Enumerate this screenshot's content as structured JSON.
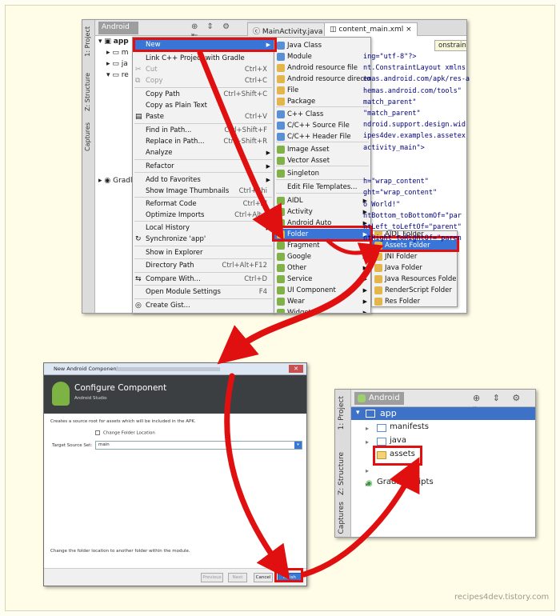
{
  "ide": {
    "vtabs": [
      "1: Project",
      "Z: Structure",
      "Captures"
    ],
    "project_dropdown": "Android",
    "tree": [
      {
        "label": "app"
      },
      {
        "label": "m"
      },
      {
        "label": "ja"
      },
      {
        "label": "re"
      },
      {
        "label": "Gradl"
      }
    ],
    "editor_tabs": [
      "MainActivity.java",
      "content_main.xml"
    ],
    "tooltip": "onstraintLayout",
    "code_lines": [
      "ing=\"utf-8\"?>",
      "nt.ConstraintLayout xmlns",
      "emas.android.com/apk/res-a",
      "hemas.android.com/tools\"",
      "match_parent\"",
      "\"match_parent\"",
      "ndroid.support.design.wid",
      "ipes4dev.examples.assetex",
      "activity_main\">",
      "",
      "",
      "h=\"wrap_content\"",
      "ght=\"wrap_content\"",
      "o World!\"",
      "ntBottom_toBottomOf=\"par",
      "ntLeft_toLeftOf=\"parent\"",
      "ntRight_toRightOf=\"paren"
    ],
    "context_menu": [
      {
        "label": "New",
        "shortcut": "",
        "state": "highlight",
        "submenu": true
      },
      {
        "label": "Link C++ Project with Gradle",
        "shortcut": "",
        "state": "normal"
      },
      {
        "label": "Cut",
        "shortcut": "Ctrl+X",
        "state": "disabled"
      },
      {
        "label": "Copy",
        "shortcut": "Ctrl+C",
        "state": "disabled"
      },
      {
        "label": "Copy Path",
        "shortcut": "Ctrl+Shift+C",
        "state": "normal"
      },
      {
        "label": "Copy as Plain Text",
        "shortcut": "",
        "state": "normal"
      },
      {
        "label": "Paste",
        "shortcut": "Ctrl+V",
        "state": "normal"
      },
      {
        "label": "Find in Path...",
        "shortcut": "Ctrl+Shift+F",
        "state": "normal"
      },
      {
        "label": "Replace in Path...",
        "shortcut": "Ctrl+Shift+R",
        "state": "normal"
      },
      {
        "label": "Analyze",
        "shortcut": "",
        "state": "normal",
        "submenu": true
      },
      {
        "label": "Refactor",
        "shortcut": "",
        "state": "normal",
        "submenu": true
      },
      {
        "label": "Add to Favorites",
        "shortcut": "",
        "state": "normal",
        "submenu": true
      },
      {
        "label": "Show Image Thumbnails",
        "shortcut": "Ctrl+Shi",
        "state": "normal"
      },
      {
        "label": "Reformat Code",
        "shortcut": "Ctrl+Al",
        "state": "normal"
      },
      {
        "label": "Optimize Imports",
        "shortcut": "Ctrl+Alt+",
        "state": "normal"
      },
      {
        "label": "Local History",
        "shortcut": "",
        "state": "normal",
        "submenu": true
      },
      {
        "label": "Synchronize 'app'",
        "shortcut": "",
        "state": "normal"
      },
      {
        "label": "Show in Explorer",
        "shortcut": "",
        "state": "normal"
      },
      {
        "label": "Directory Path",
        "shortcut": "Ctrl+Alt+F12",
        "state": "normal"
      },
      {
        "label": "Compare With...",
        "shortcut": "Ctrl+D",
        "state": "normal"
      },
      {
        "label": "Open Module Settings",
        "shortcut": "F4",
        "state": "normal"
      },
      {
        "label": "Create Gist...",
        "shortcut": "",
        "state": "normal"
      }
    ],
    "new_submenu": [
      "Java Class",
      "Module",
      "Android resource file",
      "Android resource directory",
      "File",
      "Package",
      "C++ Class",
      "C/C++ Source File",
      "C/C++ Header File",
      "Image Asset",
      "Vector Asset",
      "Singleton",
      "Edit File Templates...",
      "AIDL",
      "Activity",
      "Android Auto",
      "Folder",
      "Fragment",
      "Google",
      "Other",
      "Service",
      "UI Component",
      "Wear",
      "Widget"
    ],
    "folder_submenu": [
      "AIDL Folder",
      "Assets Folder",
      "JNI Folder",
      "Java Folder",
      "Java Resources Folder",
      "RenderScript Folder",
      "Res Folder"
    ]
  },
  "dialog": {
    "window_title": "New Android Component",
    "close_glyph": "✕",
    "title": "Configure Component",
    "subtitle": "Android Studio",
    "description": "Creates a source root for assets which will be included in the APK.",
    "checkbox_label": "Change Folder Location",
    "target_label": "Target Source Set:",
    "target_value": "main",
    "footer_text": "Change the folder location to another folder within the module.",
    "buttons": {
      "previous": "Previous",
      "next": "Next",
      "cancel": "Cancel",
      "finish": "Finish"
    }
  },
  "result": {
    "vtabs": [
      "1: Project",
      "Z: Structure",
      "Captures"
    ],
    "project_dropdown": "Android",
    "tree": {
      "app": "app",
      "manifests": "manifests",
      "java": "java",
      "assets": "assets",
      "gradle": "Gradle Scripts"
    }
  },
  "watermark": "recipes4dev.tistory.com",
  "colors": {
    "highlight": "#3875d7",
    "annotation_red": "#e01010",
    "page_bg": "#fffde8"
  }
}
